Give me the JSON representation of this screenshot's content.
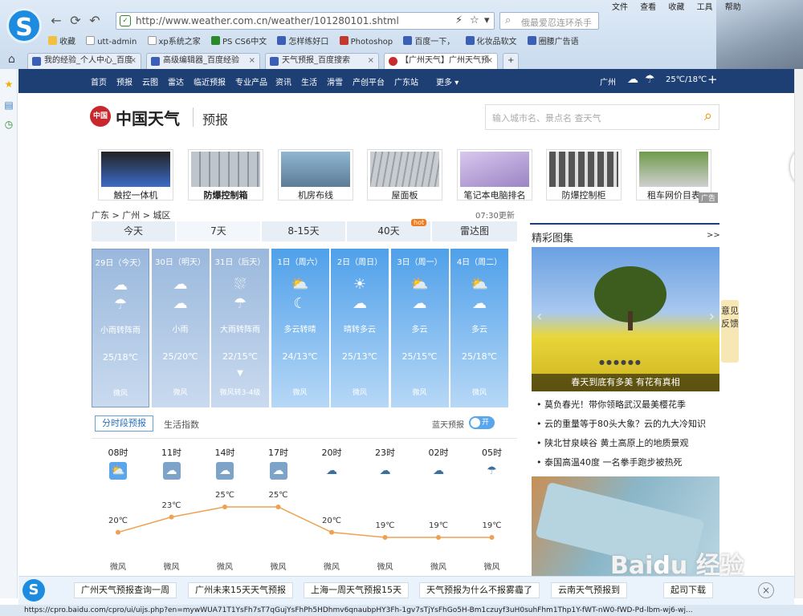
{
  "browser": {
    "url": "http://www.weather.com.cn/weather/101280101.shtml",
    "search_placeholder": "俄最爱忍连环杀手",
    "menu": [
      "文件",
      "查看",
      "收藏",
      "工具",
      "帮助"
    ],
    "bookmarks": [
      "收藏",
      "utt-admin",
      "xp系统之家",
      "PS CS6中文",
      "怎样练好口",
      "Photoshop",
      "百度一下，",
      "化妆品软文",
      "圈腰广告语"
    ],
    "tabs": [
      "我的经验_个人中心_百度",
      "高级编辑器_百度经验",
      "天气预报_百度搜索",
      "【广州天气】广州天气预"
    ],
    "status_url": "https://cpro.baidu.com/cpro/ui/uijs.php?en=mywWUA71T1YsFh7sT7qGujYsFhPh5HDhmv6qnaubpHY3Fh-1gv7sTjYsFhGo5H-Bm1czuyf3uH0suhFhm1Thp1Y-fWT-nW0-fWD-Pd-lbm-wj6-wj..."
  },
  "site": {
    "nav": [
      "首页",
      "预报",
      "云图",
      "雷达",
      "临近预报",
      "专业产品",
      "资讯",
      "生活",
      "滑雪",
      "产创平台",
      "广东站"
    ],
    "more": "更多",
    "city": "广州",
    "temp_range": "25℃/18℃",
    "brand": "中国天气",
    "brand_icon": "中国",
    "section": "预报",
    "search_placeholder": "输入城市名、景点名 查天气",
    "ads": [
      "触控一体机",
      "防爆控制箱",
      "机房布线",
      "屋面板",
      "笔记本电脑排名",
      "防爆控制柜",
      "租车网价目表"
    ],
    "ad_tag": "广告",
    "breadcrumb": "广东 > 广州 > 城区",
    "updated": "07:30更新",
    "forecast_tabs": [
      "今天",
      "7天",
      "8-15天",
      "40天",
      "雷达图"
    ],
    "hot": "hot"
  },
  "days": [
    {
      "date": "29日（今天）",
      "weather": "小雨转阵雨",
      "temp": "25/18℃",
      "wind": "微风",
      "i1": "rain-cloud-icon",
      "i2": "shower-icon"
    },
    {
      "date": "30日（明天）",
      "weather": "小雨",
      "temp": "25/20℃",
      "wind": "微风",
      "i1": "rain-cloud-icon",
      "i2": "rain-cloud-icon"
    },
    {
      "date": "31日（后天）",
      "weather": "大雨转阵雨",
      "temp": "22/15℃",
      "wind": "微风转3-4级",
      "i1": "heavy-rain-icon",
      "i2": "shower-icon",
      "arrow": "▼"
    },
    {
      "date": "1日（周六）",
      "weather": "多云转晴",
      "temp": "24/13℃",
      "wind": "微风",
      "i1": "partly-cloudy-icon",
      "i2": "moon-icon"
    },
    {
      "date": "2日（周日）",
      "weather": "晴转多云",
      "temp": "25/13℃",
      "wind": "微风",
      "i1": "sun-icon",
      "i2": "cloud-icon"
    },
    {
      "date": "3日（周一）",
      "weather": "多云",
      "temp": "25/15℃",
      "wind": "微风",
      "i1": "partly-cloudy-icon",
      "i2": "partly-cloudy-night-icon"
    },
    {
      "date": "4日（周二）",
      "weather": "多云",
      "temp": "25/18℃",
      "wind": "微风",
      "i1": "partly-cloudy-icon",
      "i2": "partly-cloudy-night-icon"
    }
  ],
  "subtabs": {
    "hourly": "分时段预报",
    "life": "生活指数",
    "bluesky": "蓝天预报",
    "toggle": "开"
  },
  "hourly": [
    {
      "hour": "08时",
      "temp": "20℃",
      "wind": "微风",
      "icon": "partly-cloudy-icon"
    },
    {
      "hour": "11时",
      "temp": "23℃",
      "wind": "微风",
      "icon": "rain-cloud-icon"
    },
    {
      "hour": "14时",
      "temp": "25℃",
      "wind": "微风",
      "icon": "rain-cloud-icon"
    },
    {
      "hour": "17时",
      "temp": "25℃",
      "wind": "微风",
      "icon": "rain-cloud-icon"
    },
    {
      "hour": "20时",
      "temp": "20℃",
      "wind": "微风",
      "icon": "rain-cloud-icon"
    },
    {
      "hour": "23时",
      "temp": "19℃",
      "wind": "微风",
      "icon": "cloud-night-icon"
    },
    {
      "hour": "02时",
      "temp": "19℃",
      "wind": "微风",
      "icon": "cloud-night-icon"
    },
    {
      "hour": "05时",
      "temp": "19℃",
      "wind": "微风",
      "icon": "shower-night-icon"
    }
  ],
  "chart_data": {
    "type": "line",
    "x": [
      "08时",
      "11时",
      "14时",
      "17时",
      "20时",
      "23时",
      "02时",
      "05时"
    ],
    "series": [
      {
        "values": [
          20,
          23,
          25,
          25,
          20,
          19,
          19,
          19
        ]
      }
    ]
  },
  "gallery": {
    "title": "精彩图集",
    "more": ">>",
    "caption": "春天到底有多美 有花有真相"
  },
  "news": [
    "莫负春光！带你领略武汉最美樱花季",
    "云的重量等于80头大象？云的九大冷知识",
    "陕北甘泉峡谷 黄土高原上的地质景观",
    "泰国高温40度 一名拳手跑步被热死"
  ],
  "feedback": "意见反馈",
  "bottom_links": [
    "广州天气预报查询一周",
    "广州未来15天天气预报",
    "上海一周天气预报15天",
    "天气预报为什么不报雾霾了",
    "云南天气预报到",
    "起司下载"
  ],
  "colors": {
    "nav": "#1e3f74",
    "past": "#a8c3e2",
    "future": "#5aa6ec",
    "line": "#f0a050"
  }
}
